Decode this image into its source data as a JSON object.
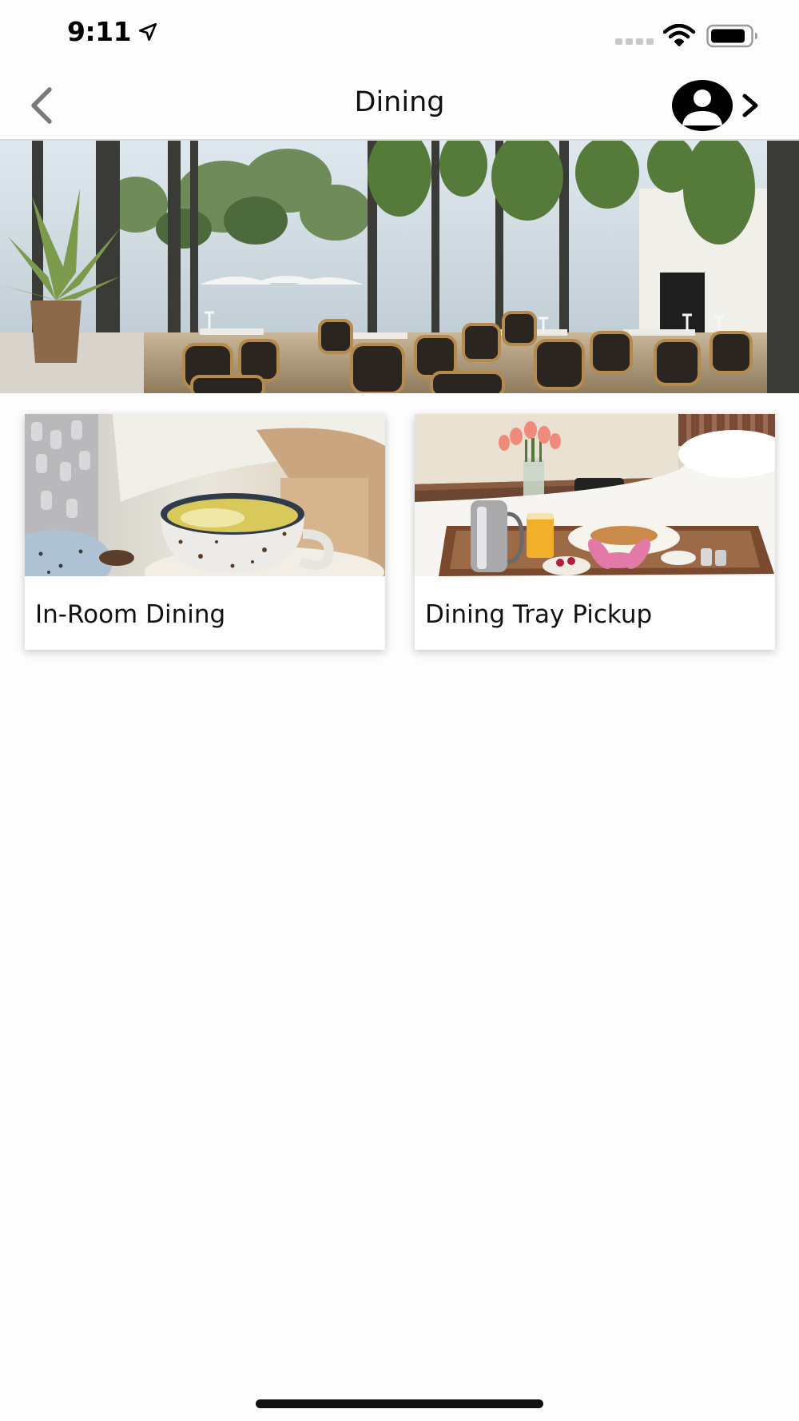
{
  "status_bar": {
    "time": "9:11",
    "icons": [
      "location-arrow-icon",
      "signal-icon",
      "wifi-icon",
      "battery-icon"
    ]
  },
  "nav": {
    "title": "Dining",
    "back_icon": "chevron-left-icon",
    "profile_icon": "user-circle-icon",
    "profile_chevron_icon": "chevron-right-icon"
  },
  "hero": {
    "image": "restaurant-dining-room-photo"
  },
  "cards": [
    {
      "label": "In-Room Dining",
      "image": "tea-cup-photo"
    },
    {
      "label": "Dining Tray Pickup",
      "image": "breakfast-tray-photo"
    }
  ],
  "colors": {
    "background": "#fdfdfd",
    "text": "#111111",
    "divider": "#d9d9d9",
    "back_chevron": "#7a7a7a"
  }
}
